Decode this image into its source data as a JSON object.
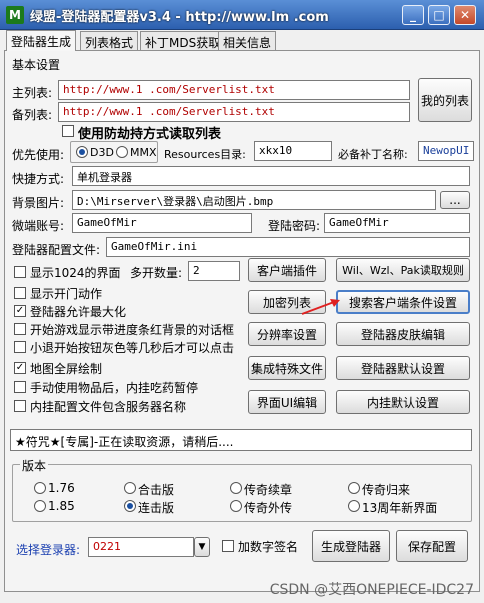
{
  "window": {
    "icon_text": "M",
    "title": "绿盟-登陆器配置器v3.4 - http://www.lm   .com",
    "min": "_",
    "max": "□",
    "close": "✕"
  },
  "tabs": [
    "登陆器生成",
    "列表格式",
    "补丁MDS获取",
    "相关信息"
  ],
  "basic": {
    "heading": "基本设置",
    "main_list_label": "主列表:",
    "main_list_value": "http://www.1      .com/Serverlist.txt",
    "backup_list_label": "备列表:",
    "backup_list_value": "http://www.1      .com/Serverlist.txt",
    "my_list_button": "我的列表",
    "anti_hijack_label": "使用防劫持方式读取列表"
  },
  "priority": {
    "label": "优先使用:",
    "d3d": "D3D",
    "mmx": "MMX",
    "resources_label": "Resources目录:",
    "resources_value": "xkx10",
    "patch_name_label": "必备补丁名称:",
    "patch_name_value": "NewopUI"
  },
  "shortcut": {
    "label": "快捷方式:",
    "value": "单机登录器"
  },
  "background": {
    "label": "背景图片:",
    "value": "D:\\Mirserver\\登录器\\启动图片.bmp",
    "browse": "..."
  },
  "account": {
    "user_label": "微端账号:",
    "user_value": "GameOfMir",
    "pass_label": "登陆密码:",
    "pass_value": "GameOfMir"
  },
  "config_file": {
    "label": "登陆器配置文件:",
    "value": "GameOfMir.ini"
  },
  "options": {
    "show_1024": "显示1024的界面",
    "multi_label": "多开数量:",
    "multi_value": "2",
    "show_intro": "显示开门动作",
    "allow_max": "登陆器允许最大化",
    "show_progress": "开始游戏显示带进度条红背景的对话框",
    "small_exit": "小退开始按钮灰色等几秒后才可以点击",
    "fullscreen_map": "地图全屏绘制",
    "manual_pause": "手动使用物品后，内挂吃药暂停",
    "plugin_server": "内挂配置文件包含服务器名称"
  },
  "buttons": {
    "client_plugin": "客户端插件",
    "read_rules": "Wil、Wzl、Pak读取规则",
    "encrypt_list": "加密列表",
    "search_client": "搜索客户端条件设置",
    "resolution": "分辨率设置",
    "skin_edit": "登陆器皮肤编辑",
    "integrate": "集成特殊文件",
    "default_settings": "登陆器默认设置",
    "ui_edit": "界面UI编辑",
    "plugin_default": "内挂默认设置"
  },
  "status_text": "★符咒★[专属]-正在读取资源，请稍后....",
  "version": {
    "heading": "版本",
    "options": [
      "1.76",
      "合击版",
      "传奇续章",
      "传奇归来",
      "1.85",
      "连击版",
      "传奇外传",
      "13周年新界面"
    ],
    "selected_index": 5
  },
  "bottom": {
    "select_label": "选择登录器:",
    "select_value": "0221",
    "sign_label": "加数字签名",
    "generate_button": "生成登陆器",
    "save_button": "保存配置"
  },
  "watermark": "CSDN @艾西ONEPIECE-IDC27",
  "colors": {
    "accent": "#4a7ec8",
    "arrow": "#e02020",
    "url_red": "#b00000",
    "select_red": "#c00000"
  }
}
